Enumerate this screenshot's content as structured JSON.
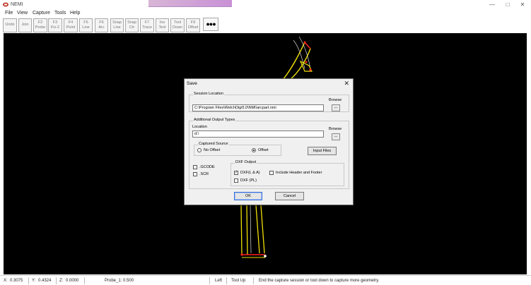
{
  "window": {
    "title": "NEMI"
  },
  "menu": [
    "File",
    "View",
    "Capture",
    "Tools",
    "Help"
  ],
  "toolbar": {
    "buttons": [
      {
        "top": "Undo",
        "bottom": ""
      },
      {
        "top": "Join",
        "bottom": ""
      },
      {
        "top": "F2",
        "bottom": "Probe"
      },
      {
        "top": "F3",
        "bottom": "Fix-2"
      },
      {
        "top": "F4",
        "bottom": "Point"
      },
      {
        "top": "F5",
        "bottom": "Line"
      },
      {
        "top": "F6",
        "bottom": "Arc"
      },
      {
        "top": "Snap",
        "bottom": "Line"
      },
      {
        "top": "Snap",
        "bottom": "Ctr"
      },
      {
        "top": "F7",
        "bottom": "Trace"
      },
      {
        "top": "Ins",
        "bottom": "Text"
      },
      {
        "top": "Tool",
        "bottom": "Down"
      },
      {
        "top": "F9",
        "bottom": "Offset"
      }
    ],
    "more_label": "●●●"
  },
  "dialog": {
    "title": "Save",
    "session_location": {
      "group_label": "Session Location",
      "path": "C:\\Program Files\\WelchDigi5.0\\NMI\\arcpart.nmi",
      "browse_label": "Browse",
      "browse_button": "..."
    },
    "additional_output": {
      "group_label": "Additional Output Types",
      "location_label": "Location",
      "location_value": "d:\\",
      "browse_label": "Browse",
      "browse_button": "...",
      "captured_source_label": "Captured Source",
      "no_offset_label": "No Offset",
      "offset_label": "Offset",
      "selected_source": "Offset",
      "input_files_label": "Input Files",
      "gcode_label": ".GCODE",
      "scr_label": ".SCR",
      "dxf_output_label": "DXF Output",
      "dxf_la_label": "DXF(L & A)",
      "dxf_pl_label": "DXF (PL)",
      "header_footer_label": "Include Header and Footer",
      "gcode_checked": false,
      "scr_checked": false,
      "dxf_la_checked": true,
      "dxf_pl_checked": false,
      "header_footer_checked": false
    },
    "ok_label": "OK",
    "cancel_label": "Cancel"
  },
  "status": {
    "x_label": "X:",
    "x_value": "0.3075",
    "y_label": "Y:",
    "y_value": "0.4324",
    "z_label": "Z:",
    "z_value": "0.0000",
    "probe": "Probe_1: 0.500",
    "side": "Left",
    "tool_state": "Tool Up",
    "message": "End the capture session or tool down to capture more geometry."
  },
  "colors": {
    "canvas_bg": "#000000",
    "geometry_yellow": "#f0e000",
    "geometry_red": "#ff2020",
    "accent_blue": "#3a6fd8"
  }
}
